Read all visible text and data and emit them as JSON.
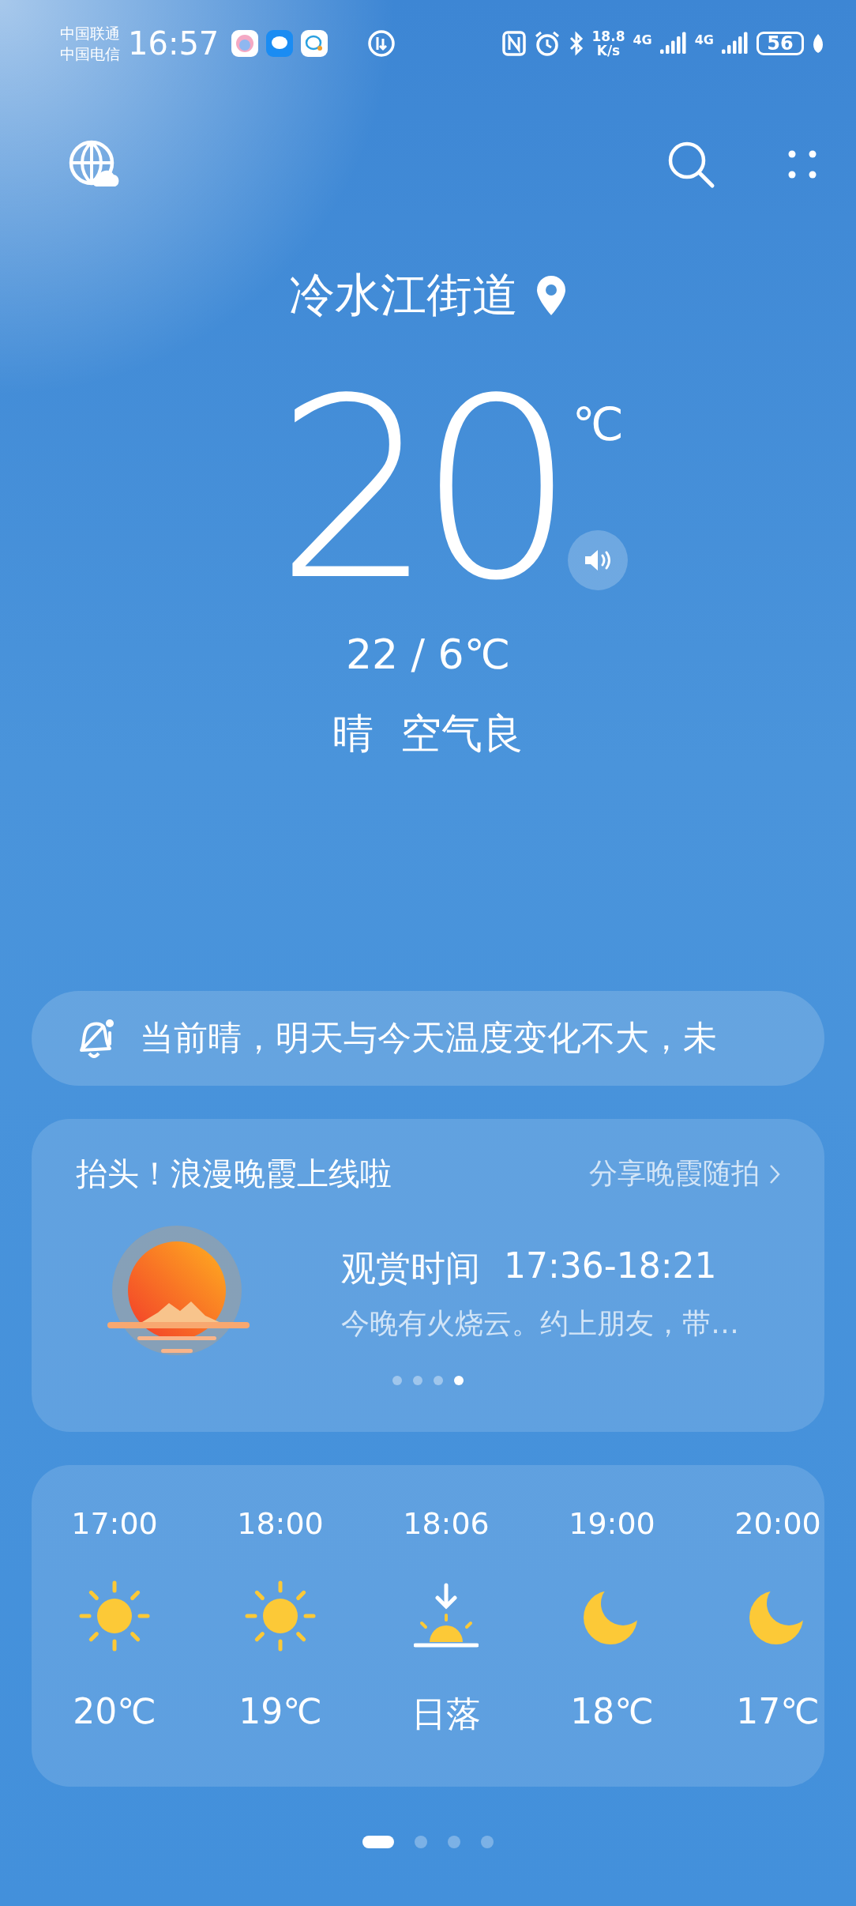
{
  "status_bar": {
    "carriers": [
      "中国联通",
      "中国电信"
    ],
    "time": "16:57",
    "speed_value": "18.8",
    "speed_unit": "K/s",
    "networks": [
      "4G",
      "4G"
    ],
    "battery": "56"
  },
  "location": "冷水江街道",
  "temperature": "20",
  "unit": "℃",
  "range": "22 / 6℃",
  "condition": "晴  空气良",
  "alert": "当前晴，明天与今天温度变化不大，未",
  "sunset_card": {
    "title": "抬头！浪漫晚霞上线啦",
    "action": "分享晚霞随拍",
    "time_label": "观赏时间",
    "time_value": "17:36-18:21",
    "description": "今晚有火烧云。约上朋友，带…",
    "dots": [
      {
        "selected": false
      },
      {
        "selected": false
      },
      {
        "selected": false
      },
      {
        "selected": true
      }
    ]
  },
  "hourly": [
    {
      "time": "17:00",
      "kind": "sun",
      "value": "20℃"
    },
    {
      "time": "18:00",
      "kind": "sun",
      "value": "19℃"
    },
    {
      "time": "18:06",
      "kind": "sunset",
      "value": "日落"
    },
    {
      "time": "19:00",
      "kind": "moon",
      "value": "18℃"
    },
    {
      "time": "20:00",
      "kind": "moon",
      "value": "17℃"
    }
  ],
  "pages": [
    {
      "selected": true
    },
    {
      "selected": false
    },
    {
      "selected": false
    },
    {
      "selected": false
    }
  ]
}
